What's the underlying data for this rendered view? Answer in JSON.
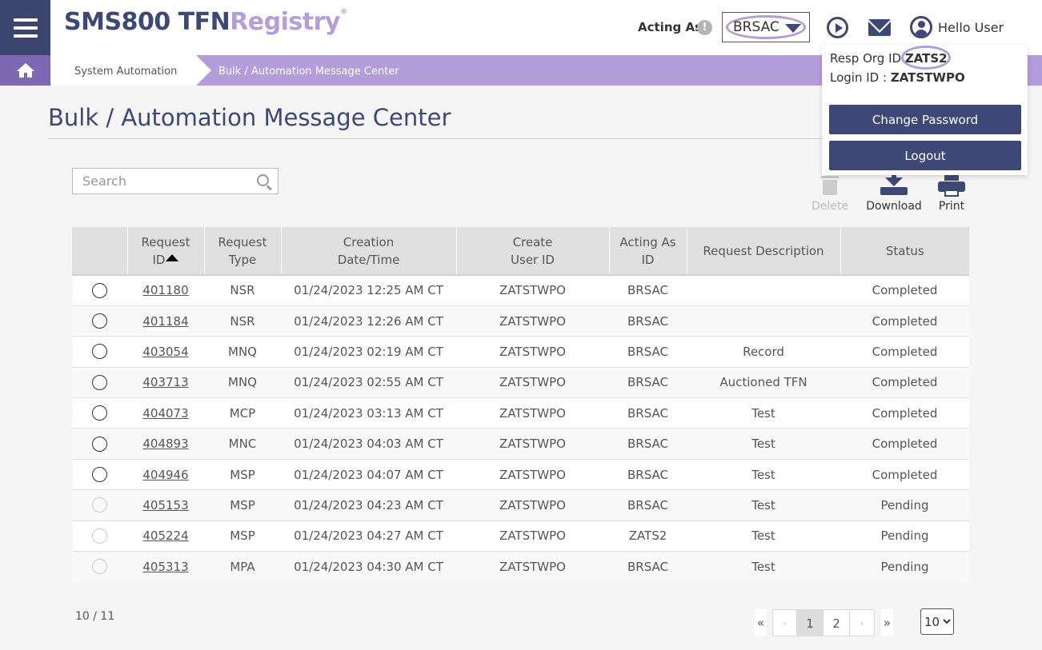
{
  "header": {
    "logo_dark": "SMS800 TFN",
    "logo_light": "Registry",
    "logo_mark": "®",
    "acting_as_label": "Acting As",
    "acting_as_value": "BRSAC",
    "warning_glyph": "!",
    "greeting": "Hello User"
  },
  "breadcrumb": {
    "items": [
      "System Automation",
      "Bulk / Automation Message Center"
    ]
  },
  "page_title": "Bulk / Automation Message Center",
  "search": {
    "placeholder": "Search",
    "value": ""
  },
  "toolbar": {
    "delete_label": "Delete",
    "download_label": "Download",
    "print_label": "Print"
  },
  "table": {
    "headers": {
      "request_id_1": "Request",
      "request_id_2": "ID",
      "request_type_1": "Request",
      "request_type_2": "Type",
      "creation_1": "Creation",
      "creation_2": "Date/Time",
      "create_user_1": "Create",
      "create_user_2": "User ID",
      "acting_as_1": "Acting As",
      "acting_as_2": "ID",
      "description": "Request Description",
      "status": "Status"
    },
    "rows": [
      {
        "id": "401180",
        "type": "NSR",
        "created": "01/24/2023 12:25 AM CT",
        "user": "ZATSTWPO",
        "acting": "BRSAC",
        "desc": "",
        "status": "Completed",
        "selectable": true
      },
      {
        "id": "401184",
        "type": "NSR",
        "created": "01/24/2023 12:26 AM CT",
        "user": "ZATSTWPO",
        "acting": "BRSAC",
        "desc": "",
        "status": "Completed",
        "selectable": true
      },
      {
        "id": "403054",
        "type": "MNQ",
        "created": "01/24/2023 02:19 AM CT",
        "user": "ZATSTWPO",
        "acting": "BRSAC",
        "desc": "Record",
        "status": "Completed",
        "selectable": true
      },
      {
        "id": "403713",
        "type": "MNQ",
        "created": "01/24/2023 02:55 AM CT",
        "user": "ZATSTWPO",
        "acting": "BRSAC",
        "desc": "Auctioned TFN",
        "status": "Completed",
        "selectable": true
      },
      {
        "id": "404073",
        "type": "MCP",
        "created": "01/24/2023 03:13 AM CT",
        "user": "ZATSTWPO",
        "acting": "BRSAC",
        "desc": "Test",
        "status": "Completed",
        "selectable": true
      },
      {
        "id": "404893",
        "type": "MNC",
        "created": "01/24/2023 04:03 AM CT",
        "user": "ZATSTWPO",
        "acting": "BRSAC",
        "desc": "Test",
        "status": "Completed",
        "selectable": true
      },
      {
        "id": "404946",
        "type": "MSP",
        "created": "01/24/2023 04:07 AM CT",
        "user": "ZATSTWPO",
        "acting": "BRSAC",
        "desc": "Test",
        "status": "Completed",
        "selectable": true
      },
      {
        "id": "405153",
        "type": "MSP",
        "created": "01/24/2023 04:23 AM CT",
        "user": "ZATSTWPO",
        "acting": "BRSAC",
        "desc": "Test",
        "status": "Pending",
        "selectable": false
      },
      {
        "id": "405224",
        "type": "MSP",
        "created": "01/24/2023 04:27 AM CT",
        "user": "ZATSTWPO",
        "acting": "ZATS2",
        "desc": "Test",
        "status": "Pending",
        "selectable": false
      },
      {
        "id": "405313",
        "type": "MPA",
        "created": "01/24/2023 04:30 AM CT",
        "user": "ZATSTWPO",
        "acting": "BRSAC",
        "desc": "Test",
        "status": "Pending",
        "selectable": false
      }
    ]
  },
  "pagination": {
    "count_text": "10 / 11",
    "first": "«",
    "prev": "‹",
    "pages": [
      "1",
      "2"
    ],
    "current_page": "1",
    "next": "›",
    "last": "»",
    "page_size": "10"
  },
  "user_menu": {
    "resp_org_label": "Resp Org ID ",
    "resp_org_value": "ZATS2",
    "login_label": "Login ID : ",
    "login_value": "ZATSTWPO",
    "change_password": "Change Password",
    "logout": "Logout"
  },
  "colors": {
    "brand_dark": "#3d4876",
    "brand_light": "#b39ddb",
    "home_button": "#7e68b3"
  },
  "icons": [
    "menu-icon",
    "warning-icon",
    "play-circle-icon",
    "mail-icon",
    "user-icon",
    "home-icon",
    "search-icon",
    "trash-icon",
    "download-icon",
    "print-icon",
    "sort-up-icon"
  ]
}
